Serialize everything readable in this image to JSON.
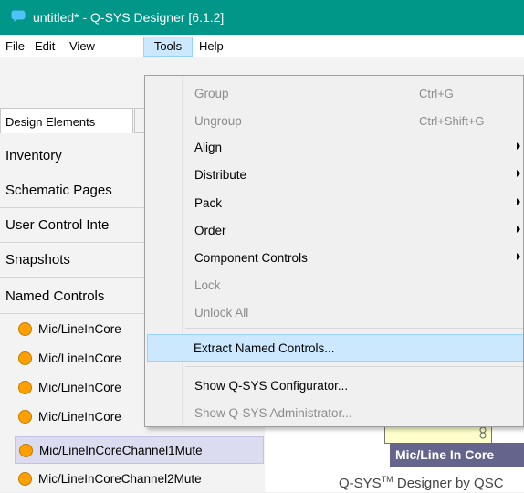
{
  "window": {
    "title": "untitled* - Q-SYS Designer [6.1.2]"
  },
  "menubar": {
    "items": [
      "File",
      "Edit",
      "View",
      "Tools",
      "Help"
    ]
  },
  "left_panel": {
    "tab_label": "Design Elements",
    "sections": [
      "Inventory",
      "Schematic Pages",
      "User Control Inte",
      "Snapshots",
      "Named Controls"
    ],
    "named_controls": [
      "Mic/LineInCore",
      "Mic/LineInCore",
      "Mic/LineInCore",
      "Mic/LineInCore",
      "Mic/LineInCoreChannel1Mute",
      "Mic/LineInCoreChannel2Mute"
    ]
  },
  "tools_menu": {
    "items": [
      {
        "label": "Group",
        "shortcut": "Ctrl+G",
        "disabled": true
      },
      {
        "label": "Ungroup",
        "shortcut": "Ctrl+Shift+G",
        "disabled": true
      },
      {
        "label": "Align",
        "submenu": true
      },
      {
        "label": "Distribute",
        "submenu": true
      },
      {
        "label": "Pack",
        "submenu": true
      },
      {
        "label": "Order",
        "submenu": true
      },
      {
        "label": "Component Controls",
        "submenu": true
      },
      {
        "label": "Lock",
        "disabled": true
      },
      {
        "label": "Unlock All",
        "disabled": true
      },
      {
        "label": "Extract Named Controls...",
        "highlighted": true
      },
      {
        "label": "Show Q-SYS Configurator..."
      },
      {
        "label": "Show Q-SYS Administrator...",
        "disabled": true
      }
    ]
  },
  "canvas": {
    "component_label": "Mic/Line In Core",
    "footer_brand": "Q-SYS",
    "footer_tm": "TM",
    "footer_rest": " Designer by QSC"
  },
  "colors": {
    "titlebar": "#009688",
    "highlight": "#cce8ff",
    "control_dot": "#ffa000",
    "component_label_bg": "#64648c"
  }
}
